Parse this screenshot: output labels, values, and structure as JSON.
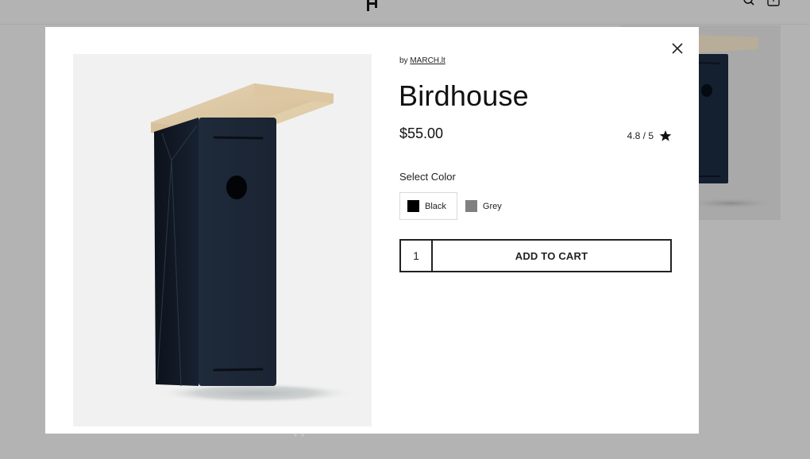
{
  "header": {
    "logo_icon": "h-logo-icon",
    "search_icon": "search-icon",
    "cart_icon": "shopping-bag-icon"
  },
  "modal": {
    "close_icon": "close-icon",
    "image_alt": "Black birdhouse with wooden roof",
    "product": {
      "by_prefix": "by",
      "brand": "MARCH.lt",
      "title": "Birdhouse",
      "price": "$55.00",
      "rating_text": "4.8 / 5",
      "rating_value": 4.8,
      "rating_max": 5,
      "rating_icon": "star-icon"
    },
    "color_selector": {
      "label": "Select Color",
      "options": [
        {
          "name": "Black",
          "color": "#000000",
          "selected": true
        },
        {
          "name": "Grey",
          "color": "#808080",
          "selected": false
        }
      ]
    },
    "cart": {
      "quantity": "1",
      "add_label": "ADD TO CART"
    }
  },
  "colors": {
    "overlay_bg": "#b3b3b3",
    "modal_bg": "#ffffff",
    "image_bg": "#f1f1f1",
    "birdhouse_body": "#1b2535",
    "wood_roof": "#d9c4a3",
    "text": "#111111"
  }
}
